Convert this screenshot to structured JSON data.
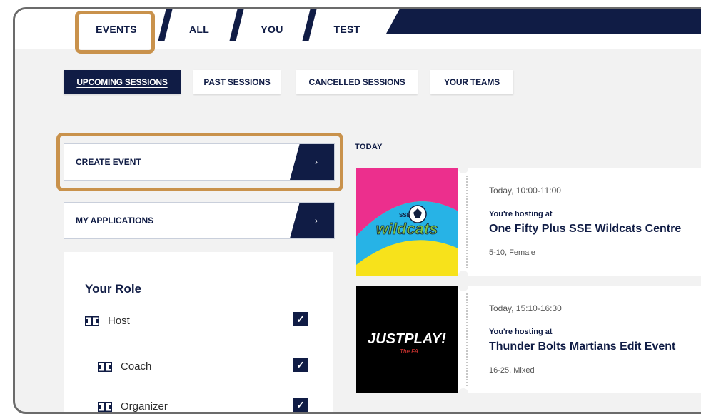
{
  "top_tabs": [
    {
      "label": "EVENTS"
    },
    {
      "label": "ALL"
    },
    {
      "label": "YOU"
    },
    {
      "label": "TEST"
    }
  ],
  "session_tabs": [
    {
      "label": "UPCOMING SESSIONS"
    },
    {
      "label": "PAST SESSIONS"
    },
    {
      "label": "CANCELLED SESSIONS"
    },
    {
      "label": "YOUR TEAMS"
    }
  ],
  "actions": {
    "create_event": "CREATE EVENT",
    "my_applications": "MY APPLICATIONS",
    "arrow": "›"
  },
  "role_panel": {
    "title": "Your Role",
    "roles": [
      {
        "label": "Host",
        "checked": true
      },
      {
        "label": "Coach",
        "checked": true
      },
      {
        "label": "Organizer",
        "checked": true
      }
    ],
    "check": "✓"
  },
  "feed": {
    "section": "TODAY",
    "events": [
      {
        "time": "Today, 10:00-11:00",
        "hosting": "You're hosting at",
        "venue": "One Fifty Plus SSE Wildcats Centre",
        "meta": "5-10, Female",
        "logo_text": "wildcats",
        "logo_tag": "SSE"
      },
      {
        "time": "Today, 15:10-16:30",
        "hosting": "You're hosting at",
        "venue": "Thunder Bolts Martians Edit Event",
        "meta": "16-25, Mixed",
        "logo_text": "JUSTPLAY!",
        "logo_tag": "The FA"
      }
    ]
  },
  "colors": {
    "navy": "#101c45",
    "highlight": "#c9924c",
    "background": "#f2f2f2"
  }
}
